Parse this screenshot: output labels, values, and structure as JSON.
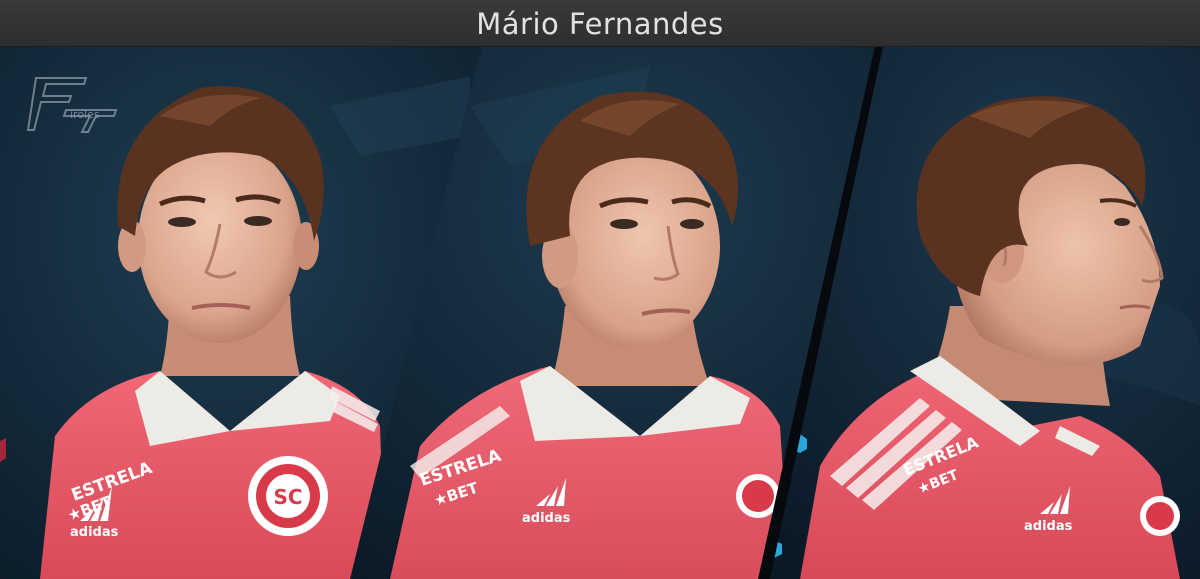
{
  "title": "Mário Fernandes",
  "watermark_text": "iroles",
  "shirt": {
    "sponsor_line1": "ESTRELA",
    "sponsor_line2": "★BET",
    "brand": "adidas"
  },
  "colors": {
    "title_bar": "#333333",
    "background": "#14293a",
    "shirt": "#e95d6a",
    "skin": "#e2b49c",
    "hair": "#5a3320",
    "divider": "#05070a"
  }
}
